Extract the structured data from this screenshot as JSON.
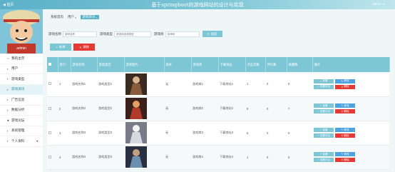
{
  "header": {
    "back_label": "◀ 首页",
    "site_title": "基于springboot的游戏网站的设计与实现",
    "username": "admin"
  },
  "sidebar": {
    "profile_name": "admin",
    "items": [
      {
        "icon": "home-icon",
        "glyph": "⌂",
        "label": "我的主页"
      },
      {
        "icon": "user-icon",
        "glyph": "▪",
        "label": "用户"
      },
      {
        "icon": "category-icon",
        "glyph": "▪",
        "label": "游戏类型"
      },
      {
        "icon": "game-icon",
        "glyph": "▪",
        "label": "游戏资讯"
      },
      {
        "icon": "ad-icon",
        "glyph": "▪",
        "label": "广告信息"
      },
      {
        "icon": "chart-icon",
        "glyph": "▪",
        "label": "数据分析"
      },
      {
        "icon": "forum-icon",
        "glyph": "♣",
        "label": "游戏论坛"
      },
      {
        "icon": "system-icon",
        "glyph": "▪",
        "label": "系统管理"
      },
      {
        "icon": "person-icon",
        "glyph": "▪",
        "label": "个人资料"
      }
    ],
    "active_index": 3
  },
  "breadcrumb": {
    "home": "系统首页",
    "tabs": [
      {
        "label": "用户"
      },
      {
        "label": "游戏资讯"
      }
    ]
  },
  "search": {
    "name_label": "游戏名称",
    "name_placeholder": "游戏名称",
    "type_label": "游戏类型",
    "type_placeholder": "请选择游戏类型",
    "vendor_label": "游戏商",
    "vendor_placeholder": "游戏商",
    "button_label": "搜索"
  },
  "actions": {
    "add_label": "新增",
    "delete_label": "删除"
  },
  "table": {
    "columns": [
      "",
      "索引",
      "游戏名称",
      "游戏类型",
      "游戏图片",
      "版本",
      "游戏商",
      "下载地址",
      "点击次数",
      "评论数",
      "收藏数",
      "操作"
    ],
    "rows": [
      {
        "index": "1",
        "name": "游戏名称1",
        "type": "游戏类型1",
        "version": "无",
        "vendor": "游戏商1",
        "download": "下载地址1",
        "clicks": "1",
        "comments": "0",
        "favorites": "0"
      },
      {
        "index": "2",
        "name": "游戏名称2",
        "type": "游戏类型2",
        "version": "无",
        "vendor": "游戏商2",
        "download": "下载地址2",
        "clicks": "9",
        "comments": "0",
        "favorites": "7"
      },
      {
        "index": "3",
        "name": "游戏名称3",
        "type": "游戏类型3",
        "version": "无",
        "vendor": "游戏商3",
        "download": "下载地址3",
        "clicks": "6",
        "comments": "0",
        "favorites": "0"
      },
      {
        "index": "4",
        "name": "游戏名称4",
        "type": "游戏类型4",
        "version": "无",
        "vendor": "游戏商4",
        "download": "下载地址4",
        "clicks": "1",
        "comments": "0",
        "favorites": "0"
      }
    ],
    "ops": {
      "view": "查看",
      "edit": "修改",
      "review": "查看评论",
      "delete": "删除"
    }
  },
  "colors": {
    "accent": "#7cc6d6",
    "danger": "#e53935",
    "edit": "#4da3e0"
  }
}
